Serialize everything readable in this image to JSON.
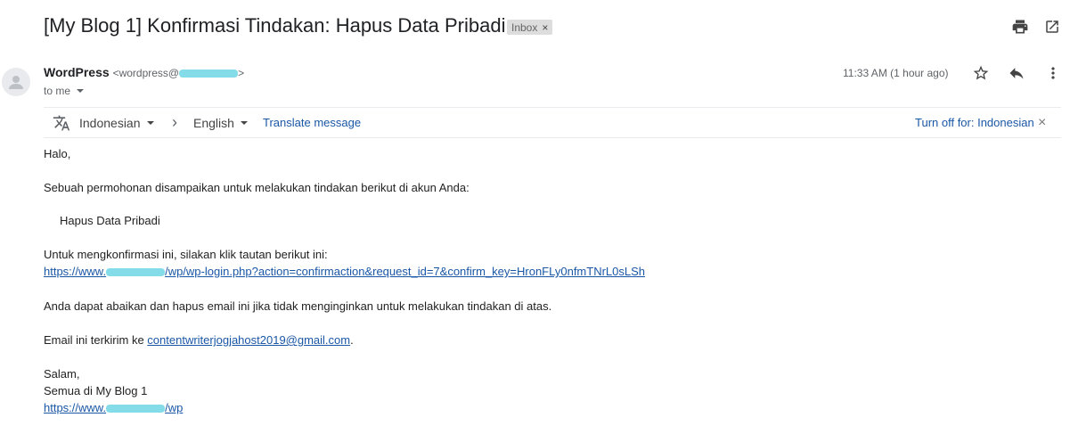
{
  "email": {
    "subject": "[My Blog 1] Konfirmasi Tindakan: Hapus Data Pribadi",
    "label": "Inbox",
    "label_remove": "×",
    "sender_name": "WordPress",
    "sender_email_prefix": "<wordpress@",
    "sender_email_suffix": ">",
    "recipient": "to me",
    "time": "11:33 AM (1 hour ago)"
  },
  "toolbar": {
    "icons": [
      "print-icon",
      "open-in-new-window-icon",
      "star-icon",
      "reply-icon",
      "more-vert-icon"
    ]
  },
  "translate": {
    "source_lang": "Indonesian",
    "arrow": "›",
    "target_lang": "English",
    "translate_link": "Translate message",
    "turn_off": "Turn off for: Indonesian",
    "close": "×"
  },
  "body": {
    "greeting": "Halo,",
    "para1": "Sebuah permohonan disampaikan untuk melakukan tindakan berikut di akun Anda:",
    "action": "Hapus Data Pribadi",
    "para2": "Untuk mengkonfirmasi ini, silakan klik tautan berikut ini:",
    "link_prefix": "https://www.",
    "link_suffix": "/wp/wp-login.php?action=confirmaction&request_id=7&confirm_key=HronFLy0nfmTNrL0sLSh",
    "para3": "Anda dapat abaikan dan hapus email ini jika tidak menginginkan untuk melakukan tindakan di atas.",
    "para4_prefix": "Email ini terkirim ke ",
    "email_link": "contentwriterjogjahost2019@gmail.com",
    "para4_suffix": ".",
    "closing": "Salam,",
    "signature": "Semua di My Blog 1",
    "footer_link_prefix": "https://www.",
    "footer_link_suffix": "/wp"
  },
  "colors": {
    "link": "#1a57a6",
    "redaction": "#84dce9",
    "chip_bg": "#dddddd"
  }
}
